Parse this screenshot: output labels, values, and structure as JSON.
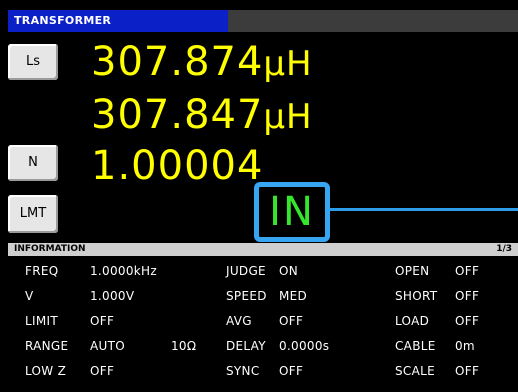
{
  "mode": {
    "title": "TRANSFORMER"
  },
  "buttons": {
    "ls": "Ls",
    "n": "N",
    "lmt": "LMT"
  },
  "measurements": {
    "value1": {
      "number": "307.874",
      "unit": "μH"
    },
    "value2": {
      "number": "307.847",
      "unit": "μH"
    },
    "value3": {
      "number": "1.00004"
    }
  },
  "judgement": "IN",
  "colors": {
    "value_text": "#ffff00",
    "judge_text": "#35e62c",
    "highlight": "#38a5f2",
    "mode_bar": "#0c20c8"
  },
  "info": {
    "title": "INFORMATION",
    "page": "1/3",
    "rows": [
      {
        "l1": "FREQ",
        "v1": "1.0000kHz",
        "v1b": "",
        "l2": "JUDGE",
        "v2": "ON",
        "l3": "OPEN",
        "v3": "OFF"
      },
      {
        "l1": "V",
        "v1": "1.000V",
        "v1b": "",
        "l2": "SPEED",
        "v2": "MED",
        "l3": "SHORT",
        "v3": "OFF"
      },
      {
        "l1": "LIMIT",
        "v1": "OFF",
        "v1b": "",
        "l2": "AVG",
        "v2": "OFF",
        "l3": "LOAD",
        "v3": "OFF"
      },
      {
        "l1": "RANGE",
        "v1": "AUTO",
        "v1b": "10Ω",
        "l2": "DELAY",
        "v2": "0.0000s",
        "l3": "CABLE",
        "v3": "0m"
      },
      {
        "l1": "LOW Z",
        "v1": "OFF",
        "v1b": "",
        "l2": "SYNC",
        "v2": "OFF",
        "l3": "SCALE",
        "v3": "OFF"
      }
    ]
  }
}
